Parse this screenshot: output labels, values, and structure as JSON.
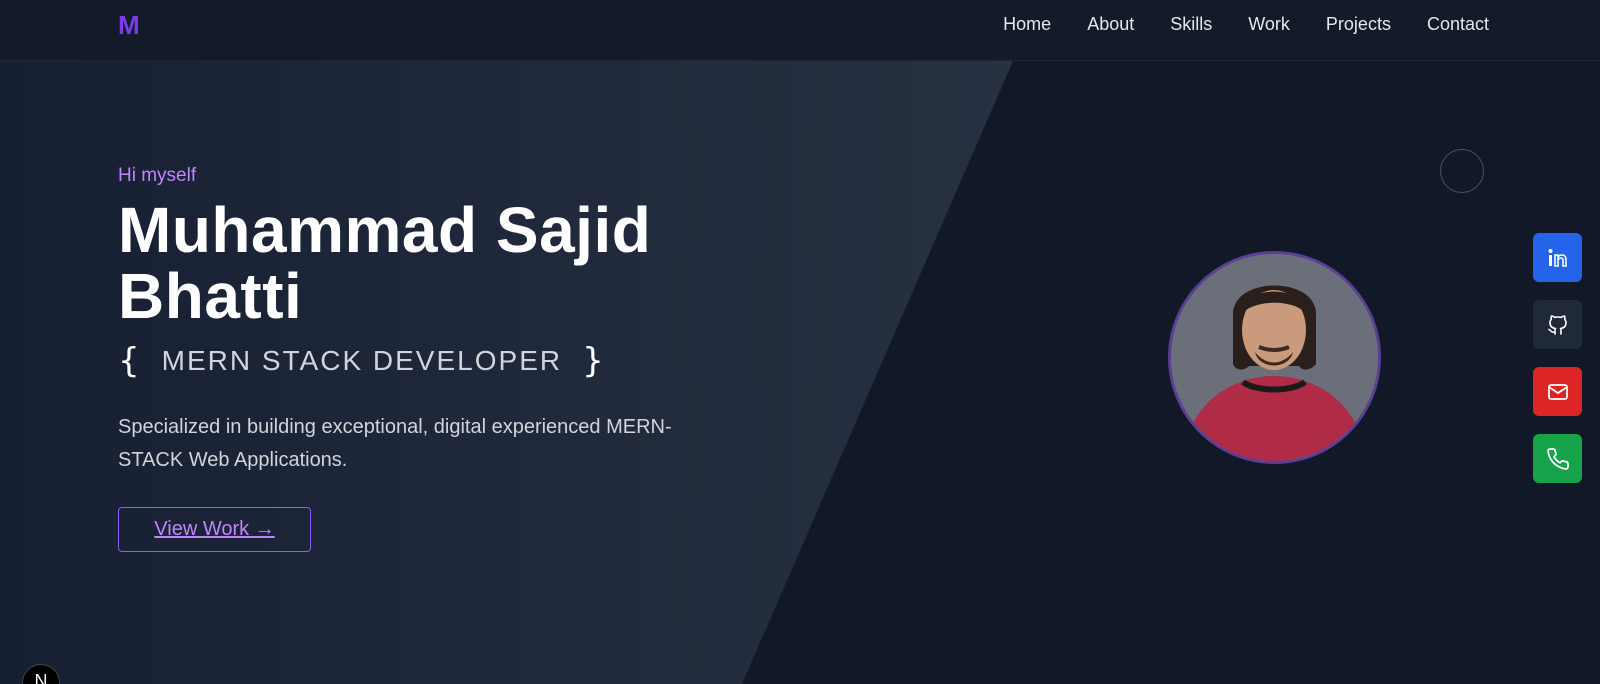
{
  "brand": {
    "logo": "M",
    "accent": "#7c3aed"
  },
  "nav": {
    "items": [
      "Home",
      "About",
      "Skills",
      "Work",
      "Projects",
      "Contact"
    ]
  },
  "hero": {
    "greeting": "Hi myself",
    "name_line1": "Muhammad Sajid",
    "name_line2": "Bhatti",
    "brace_open": "{",
    "role": "MERN STACK DEVELOPER",
    "brace_close": "}",
    "description": "Specialized in building exceptional, digital experienced MERN-STACK Web Applications.",
    "cta_label": "View Work →"
  },
  "social": {
    "linkedin": {
      "icon": "linkedin-icon",
      "color": "#2563eb"
    },
    "github": {
      "icon": "github-icon",
      "color": "#1f2937"
    },
    "mail": {
      "icon": "mail-icon",
      "color": "#dc2626"
    },
    "phone": {
      "icon": "phone-icon",
      "color": "#16a34a"
    }
  },
  "dev_badge": "N"
}
